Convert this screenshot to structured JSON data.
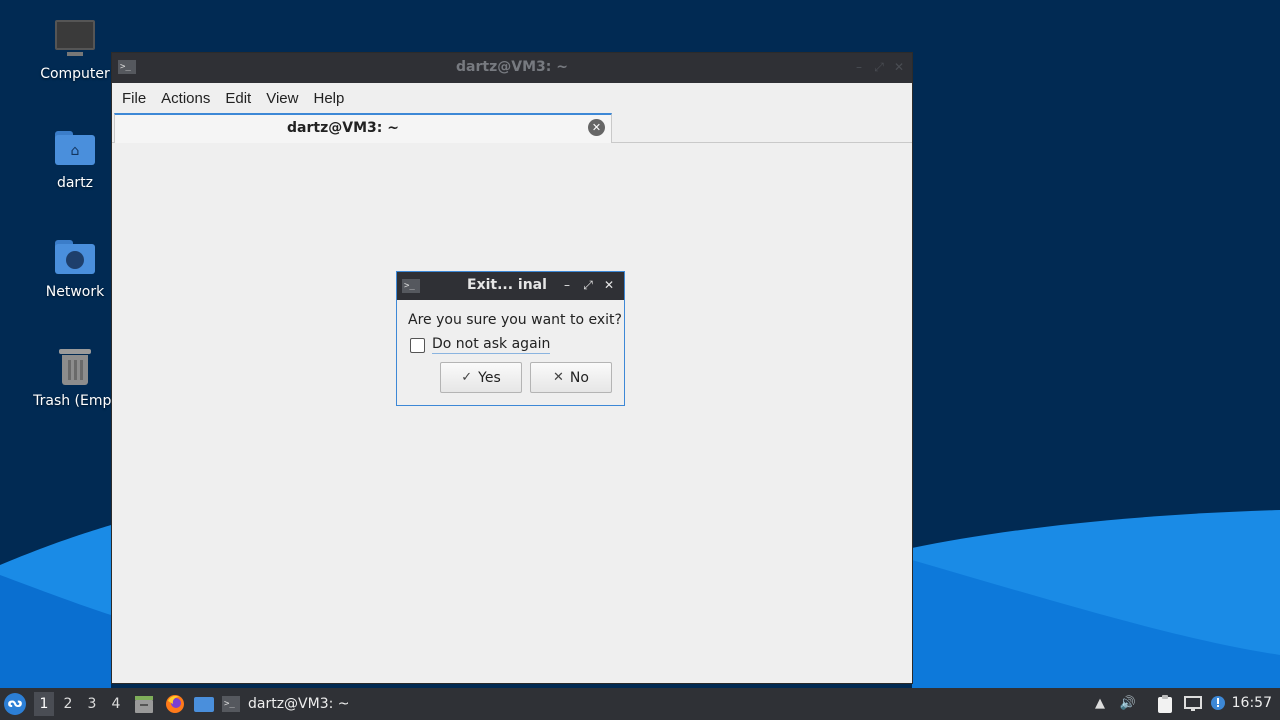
{
  "desktop": {
    "icons": [
      {
        "label": "Computer",
        "icon": "computer-icon"
      },
      {
        "label": "dartz",
        "icon": "home-folder-icon"
      },
      {
        "label": "Network",
        "icon": "network-folder-icon"
      },
      {
        "label": "Trash (Empt",
        "icon": "trash-icon"
      }
    ]
  },
  "terminal": {
    "title": "dartz@VM3: ~",
    "menu": [
      "File",
      "Actions",
      "Edit",
      "View",
      "Help"
    ],
    "tab_label": "dartz@VM3: ~"
  },
  "dialog": {
    "title": "Exit... inal",
    "message": "Are you sure you want to exit?",
    "checkbox_label": "Do not ask again",
    "checkbox_checked": false,
    "yes_label": "Yes",
    "no_label": "No"
  },
  "taskbar": {
    "workspaces": [
      "1",
      "2",
      "3",
      "4"
    ],
    "active_workspace": "1",
    "task_label": "dartz@VM3: ~",
    "clock": "16:57"
  },
  "colors": {
    "desktop_bg": "#012a53",
    "accent": "#3d88d6",
    "titlebar": "#2f3035"
  }
}
